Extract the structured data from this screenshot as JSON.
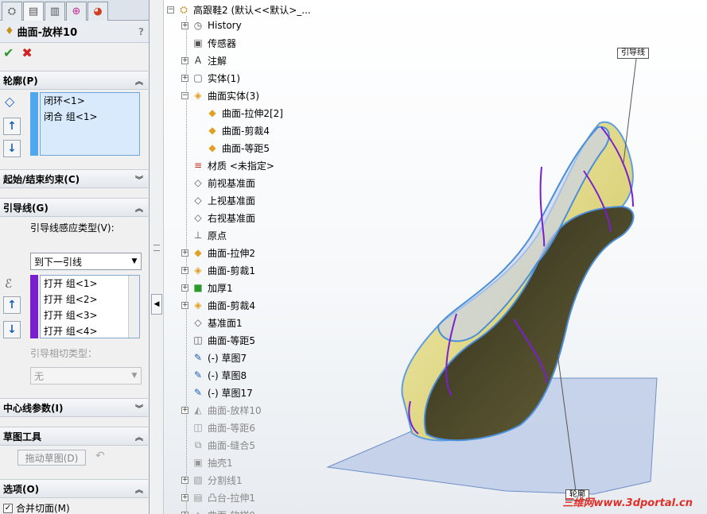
{
  "propertyManager": {
    "feature_title": "曲面-放样10",
    "help_icon": "?",
    "groups": {
      "profiles": "轮廓(P)",
      "start_end": "起始/结束约束(C)",
      "guides": "引导线(G)",
      "centerline": "中心线参数(I)",
      "sketch_tools": "草图工具",
      "options": "选项(O)"
    },
    "profiles": [
      "闭环<1>",
      "闭合 组<1>"
    ],
    "guide_influence_label": "引导线感应类型(V):",
    "guide_influence_value": "到下一引线",
    "guides": [
      "打开 组<1>",
      "打开 组<2>",
      "打开 组<3>",
      "打开 组<4>"
    ],
    "guide_tangency_label": "引导相切类型：",
    "guide_tangency_value": "无",
    "drag_sketch_button": "拖动草图(D)",
    "merge_faces": "合并切面(M)"
  },
  "tree": {
    "root": "高跟鞋2  (默认<<默认>_...",
    "items": [
      {
        "label": "History",
        "icon": "history-icon",
        "exp": "+",
        "grey": false
      },
      {
        "label": "传感器",
        "icon": "sensor-icon",
        "exp": "",
        "grey": false
      },
      {
        "label": "注解",
        "icon": "annotation-icon",
        "exp": "+",
        "grey": false
      },
      {
        "label": "实体(1)",
        "icon": "solid-bodies-icon",
        "exp": "+",
        "grey": false
      },
      {
        "label": "曲面实体(3)",
        "icon": "surface-bodies-icon",
        "exp": "-",
        "grey": false
      },
      {
        "label": "曲面-拉伸2[2]",
        "icon": "surface-icon",
        "exp": "",
        "grey": false,
        "child": true
      },
      {
        "label": "曲面-剪裁4",
        "icon": "surface-icon",
        "exp": "",
        "grey": false,
        "child": true
      },
      {
        "label": "曲面-等距5",
        "icon": "surface-icon",
        "exp": "",
        "grey": false,
        "child": true
      },
      {
        "label": "材质 <未指定>",
        "icon": "material-icon",
        "exp": "",
        "grey": false
      },
      {
        "label": "前视基准面",
        "icon": "plane-icon",
        "exp": "",
        "grey": false
      },
      {
        "label": "上视基准面",
        "icon": "plane-icon",
        "exp": "",
        "grey": false
      },
      {
        "label": "右视基准面",
        "icon": "plane-icon",
        "exp": "",
        "grey": false
      },
      {
        "label": "原点",
        "icon": "origin-icon",
        "exp": "",
        "grey": false
      },
      {
        "label": "曲面-拉伸2",
        "icon": "surface-extrude-icon",
        "exp": "+",
        "grey": false
      },
      {
        "label": "曲面-剪裁1",
        "icon": "surface-trim-icon",
        "exp": "+",
        "grey": false
      },
      {
        "label": "加厚1",
        "icon": "thicken-icon",
        "exp": "+",
        "grey": false
      },
      {
        "label": "曲面-剪裁4",
        "icon": "surface-trim-icon",
        "exp": "+",
        "grey": false
      },
      {
        "label": "基准面1",
        "icon": "plane-icon",
        "exp": "",
        "grey": false
      },
      {
        "label": "曲面-等距5",
        "icon": "surface-offset-icon",
        "exp": "",
        "grey": false
      },
      {
        "label": "(-) 草图7",
        "icon": "sketch-icon",
        "exp": "",
        "grey": false
      },
      {
        "label": "(-) 草图8",
        "icon": "sketch-icon",
        "exp": "",
        "grey": false
      },
      {
        "label": "(-) 草图17",
        "icon": "sketch-icon",
        "exp": "",
        "grey": false
      },
      {
        "label": "曲面-放样10",
        "icon": "surface-loft-icon",
        "exp": "+",
        "grey": true
      },
      {
        "label": "曲面-等距6",
        "icon": "surface-offset-icon",
        "exp": "",
        "grey": true
      },
      {
        "label": "曲面-缝合5",
        "icon": "surface-knit-icon",
        "exp": "",
        "grey": true
      },
      {
        "label": "抽壳1",
        "icon": "shell-icon",
        "exp": "",
        "grey": true
      },
      {
        "label": "分割线1",
        "icon": "split-line-icon",
        "exp": "+",
        "grey": true
      },
      {
        "label": "凸台-拉伸1",
        "icon": "boss-extrude-icon",
        "exp": "+",
        "grey": true
      },
      {
        "label": "曲面-放样9",
        "icon": "surface-loft-icon",
        "exp": "+",
        "grey": true
      }
    ]
  },
  "viewport": {
    "callout_guide": "引导线",
    "callout_profile": "轮廓",
    "watermark": "三维网www.3dportal.cn",
    "colors": {
      "shell": "#e3dc8c",
      "inner": "#3a3826",
      "edge": "#4a8fd8",
      "guide": "#7a1fd0",
      "sheet": "#a9bde0"
    }
  }
}
